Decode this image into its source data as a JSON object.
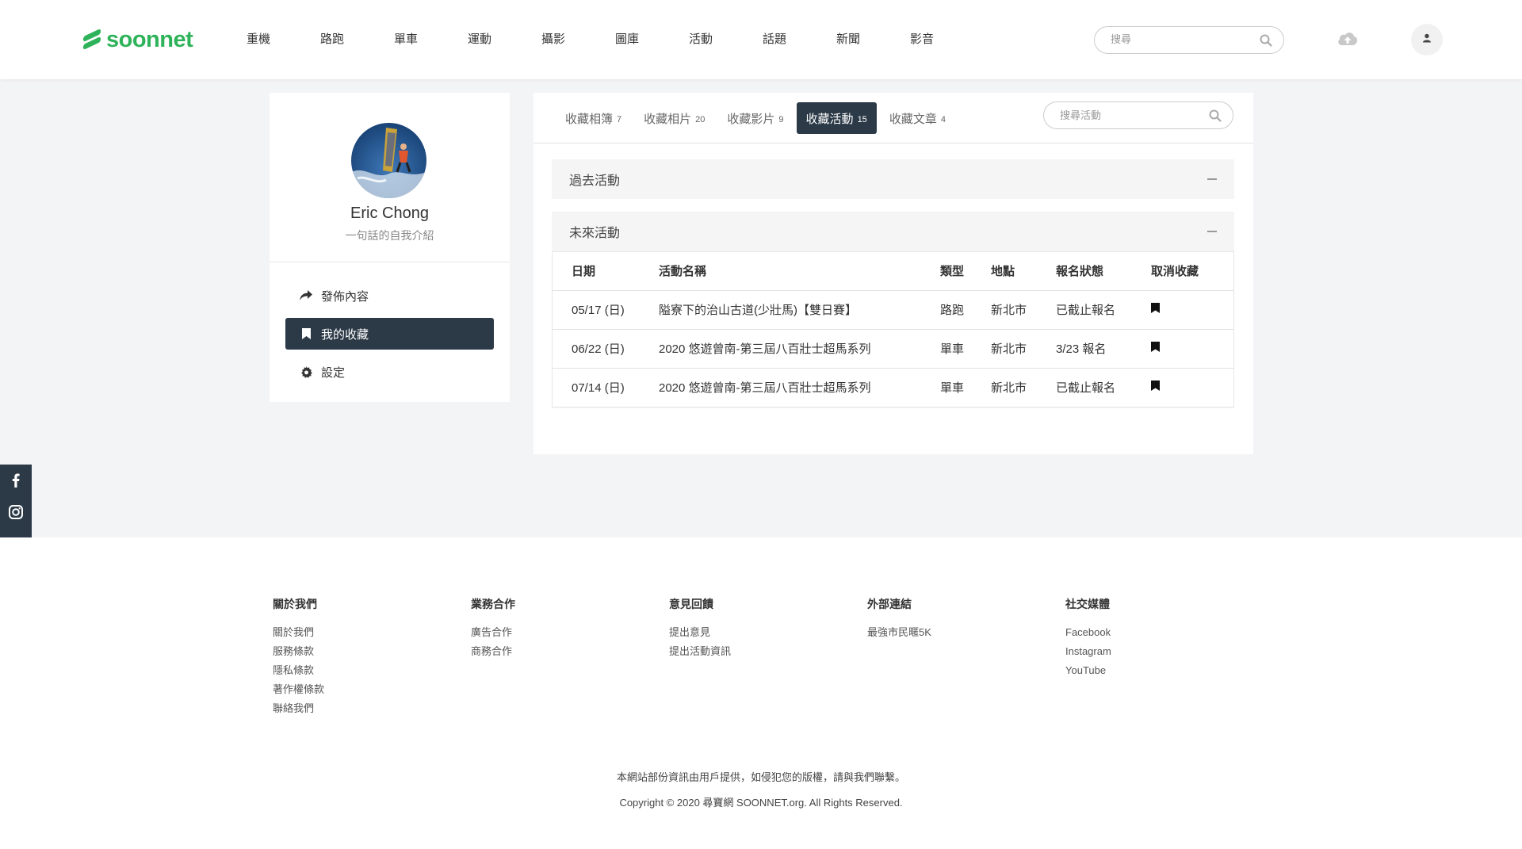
{
  "brand": {
    "name": "soonnet",
    "color": "#2fb35a"
  },
  "nav": [
    "重機",
    "路跑",
    "單車",
    "運動",
    "攝影",
    "圖庫",
    "活動",
    "話題",
    "新聞",
    "影音"
  ],
  "header": {
    "search_placeholder": "搜尋"
  },
  "profile": {
    "name": "Eric Chong",
    "bio": "一句話的自我介紹",
    "menu": [
      {
        "label": "發佈內容",
        "icon": "share-icon"
      },
      {
        "label": "我的收藏",
        "icon": "bookmark-icon"
      },
      {
        "label": "設定",
        "icon": "gear-icon"
      }
    ]
  },
  "tabs": [
    {
      "label": "收藏相簿",
      "count": "7"
    },
    {
      "label": "收藏相片",
      "count": "20"
    },
    {
      "label": "收藏影片",
      "count": "9"
    },
    {
      "label": "收藏活動",
      "count": "15"
    },
    {
      "label": "收藏文章",
      "count": "4"
    }
  ],
  "active_tab": "收藏活動",
  "panel_search_placeholder": "搜尋活動",
  "sections": {
    "past": "過去活動",
    "future": "未來活動"
  },
  "table": {
    "headers": [
      "日期",
      "活動名稱",
      "類型",
      "地點",
      "報名狀態",
      "取消收藏"
    ],
    "rows": [
      {
        "date": "05/17 (日)",
        "name": "隘寮下的治山古道(少壯馬)【雙日賽】",
        "type": "路跑",
        "location": "新北市",
        "status": "已截止報名"
      },
      {
        "date": "06/22 (日)",
        "name": "2020 悠遊曾南-第三屆八百壯士超馬系列",
        "type": "單車",
        "location": "新北市",
        "status": "3/23 報名"
      },
      {
        "date": "07/14 (日)",
        "name": "2020 悠遊曾南-第三屆八百壯士超馬系列",
        "type": "單車",
        "location": "新北市",
        "status": "已截止報名"
      }
    ]
  },
  "footer": {
    "columns": [
      {
        "title": "關於我們",
        "links": [
          "關於我們",
          "服務條款",
          "隱私條款",
          "著作權條款",
          "聯絡我們"
        ]
      },
      {
        "title": "業務合作",
        "links": [
          "廣告合作",
          "商務合作"
        ]
      },
      {
        "title": "意見回饋",
        "links": [
          "提出意見",
          "提出活動資訊"
        ]
      },
      {
        "title": "外部連結",
        "links": [
          "最強市民暱5K"
        ]
      },
      {
        "title": "社交媒體",
        "links": [
          "Facebook",
          "Instagram",
          "YouTube"
        ]
      }
    ],
    "note": "本網站部份資訊由用戶提供，如侵犯您的版權，請與我們聯繫。",
    "copyright": "Copyright © 2020 尋寶網 SOONNET.org. All Rights Reserved."
  }
}
